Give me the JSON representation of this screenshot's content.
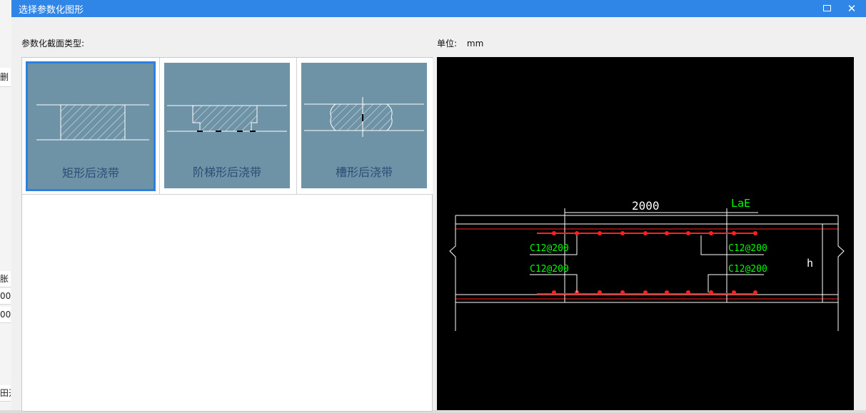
{
  "background": {
    "cells": [
      "删",
      "胀",
      "00",
      "00",
      "田开"
    ]
  },
  "dialog": {
    "title": "选择参数化图形",
    "maximize_icon": "maximize-icon",
    "close_icon": "close-icon",
    "type_label": "参数化截面类型:",
    "unit_label": "单位:",
    "unit_value": "mm"
  },
  "shapes": [
    {
      "label": "矩形后浇带",
      "selected": true
    },
    {
      "label": "阶梯形后浇带",
      "selected": false
    },
    {
      "label": "槽形后浇带",
      "selected": false
    }
  ],
  "preview": {
    "dim_width": "2000",
    "dim_lae": "LaE",
    "height_label": "h",
    "rebar_top_left": "C12@200",
    "rebar_top_right": "C12@200",
    "rebar_bottom_left": "C12@200",
    "rebar_bottom_right": "C12@200",
    "colors": {
      "rebar": "#ff2020",
      "annotation": "#00ff00",
      "line": "#ffffff"
    }
  }
}
